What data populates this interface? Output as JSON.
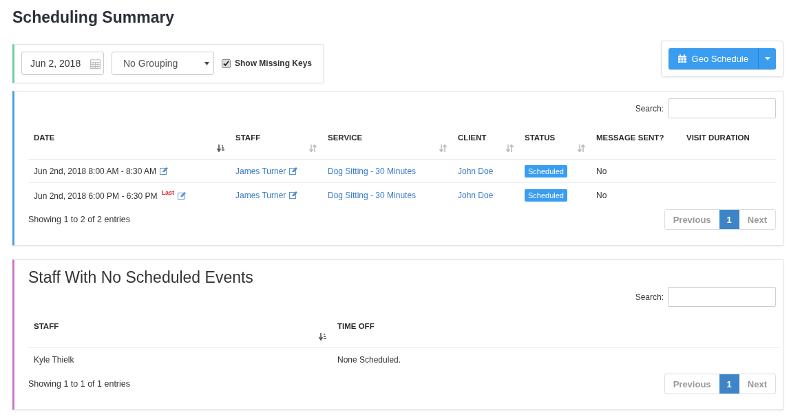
{
  "title": "Scheduling Summary",
  "filters": {
    "date": "Jun 2, 2018",
    "grouping": "No Grouping",
    "show_missing_keys": {
      "label": "Show Missing Keys",
      "checked": true
    }
  },
  "geo_button": {
    "label": "Geo Schedule"
  },
  "schedule_table": {
    "search_label": "Search:",
    "columns": [
      {
        "label": "DATE",
        "sortable": true,
        "sorted": true
      },
      {
        "label": "STAFF",
        "sortable": true,
        "sorted": false
      },
      {
        "label": "SERVICE",
        "sortable": true,
        "sorted": false
      },
      {
        "label": "CLIENT",
        "sortable": true,
        "sorted": false
      },
      {
        "label": "STATUS",
        "sortable": true,
        "sorted": false
      },
      {
        "label": "MESSAGE SENT?",
        "sortable": false,
        "sorted": false
      },
      {
        "label": "VISIT DURATION",
        "sortable": false,
        "sorted": false
      }
    ],
    "rows": [
      [
        {
          "kind": "text",
          "text": "Jun 2nd, 2018 8:00 AM - 8:30 AM",
          "editable": true
        },
        {
          "kind": "link",
          "text": "James Turner",
          "editable": true
        },
        {
          "kind": "link",
          "text": "Dog Sitting - 30 Minutes"
        },
        {
          "kind": "link",
          "text": "John Doe"
        },
        {
          "kind": "badge",
          "text": "Scheduled"
        },
        {
          "kind": "text",
          "text": "No"
        },
        {
          "kind": "text",
          "text": ""
        }
      ],
      [
        {
          "kind": "text",
          "text": "Jun 2nd, 2018 6:00 PM - 6:30 PM",
          "tag": "Last",
          "editable": true
        },
        {
          "kind": "link",
          "text": "James Turner",
          "editable": true
        },
        {
          "kind": "link",
          "text": "Dog Sitting - 30 Minutes"
        },
        {
          "kind": "link",
          "text": "John Doe"
        },
        {
          "kind": "badge",
          "text": "Scheduled"
        },
        {
          "kind": "text",
          "text": "No"
        },
        {
          "kind": "text",
          "text": ""
        }
      ]
    ],
    "info": "Showing 1 to 2 of 2 entries",
    "pagination": {
      "previous": {
        "label": "Previous",
        "disabled": true
      },
      "pages": [
        {
          "label": "1",
          "selected": true
        }
      ],
      "next": {
        "label": "Next",
        "disabled": true
      }
    }
  },
  "staff_table": {
    "heading": "Staff With No Scheduled Events",
    "search_label": "Search:",
    "columns": [
      {
        "label": "STAFF",
        "sortable": true,
        "sorted": true
      },
      {
        "label": "TIME OFF",
        "sortable": false,
        "sorted": false
      }
    ],
    "rows": [
      [
        {
          "kind": "text",
          "text": "Kyle Thielk"
        },
        {
          "kind": "text",
          "text": "None Scheduled."
        }
      ]
    ],
    "info": "Showing 1 to 1 of 1 entries",
    "pagination": {
      "previous": {
        "label": "Previous",
        "disabled": true
      },
      "pages": [
        {
          "label": "1",
          "selected": true
        }
      ],
      "next": {
        "label": "Next",
        "disabled": true
      }
    }
  }
}
